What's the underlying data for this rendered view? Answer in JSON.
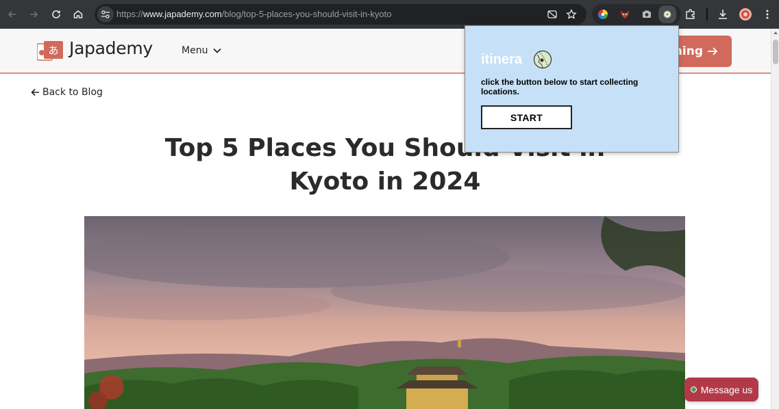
{
  "browser": {
    "url_prefix": "https://",
    "url_host": "www.japademy.com",
    "url_path": "/blog/top-5-places-you-should-visit-in-kyoto"
  },
  "site": {
    "logo_text": "Japademy",
    "logo_glyph": "あ",
    "menu_label": "Menu",
    "cta_label": "ning",
    "back_label": "Back to Blog",
    "title": "Top 5 Places You Should Visit in Kyoto in 2024",
    "message_label": "Message us"
  },
  "popup": {
    "brand": "itinera",
    "instructions": "click the button below to start collecting locations.",
    "start_label": "START"
  },
  "colors": {
    "brand": "#d16a5c",
    "message_button": "#b23a48",
    "popup_bg": "#c6e0f8",
    "chrome_bg": "#35363a"
  }
}
